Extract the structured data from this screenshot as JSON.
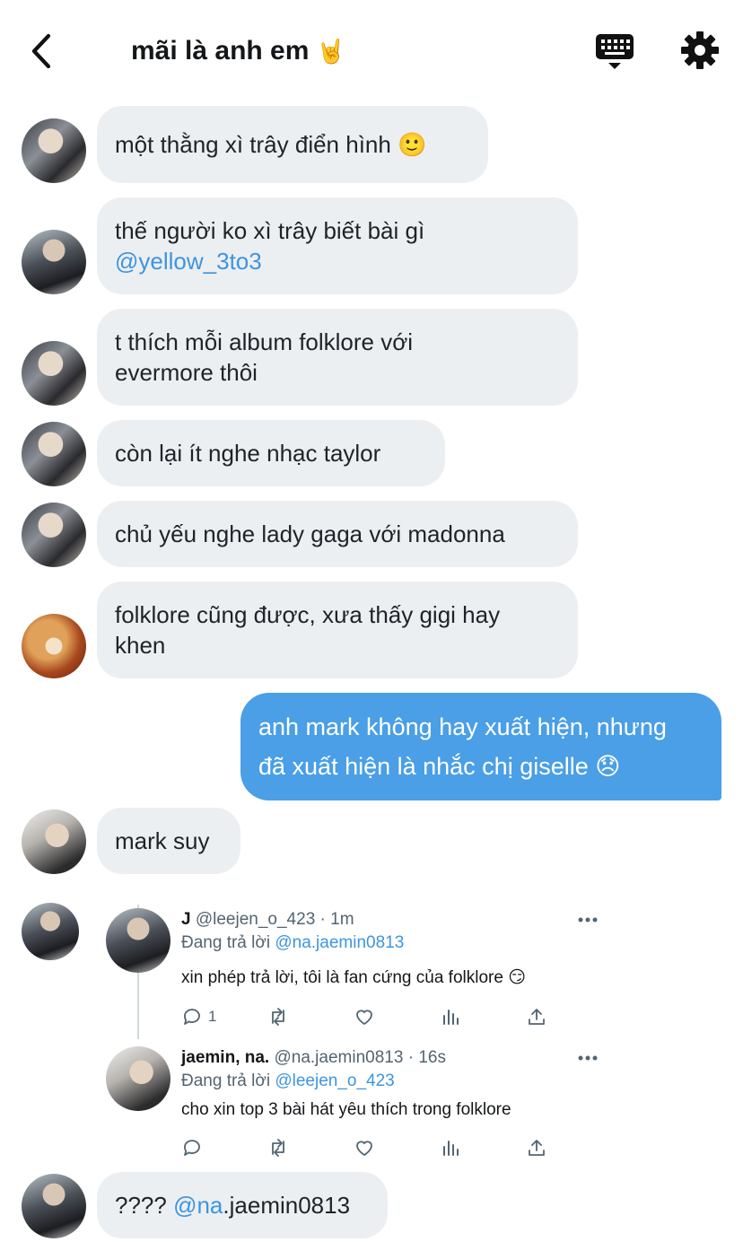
{
  "header": {
    "title": "mãi là anh em",
    "title_emoji": "🤘"
  },
  "messages": [
    {
      "text": "một thằng xì trây điển hình",
      "emoji": "🙂"
    },
    {
      "text": "thế người ko xì trây biết bài gì",
      "mention": "@yellow_3to3"
    },
    {
      "line1": "t thích mỗi album folklore với",
      "line2": "evermore thôi"
    },
    {
      "text": "còn lại ít nghe nhạc taylor"
    },
    {
      "text": "chủ yếu nghe lady gaga với madonna"
    },
    {
      "line1": "folklore cũng được, xưa thấy gigi hay",
      "line2": "khen"
    },
    {
      "line1": "anh mark không hay xuất hiện, nhưng",
      "line2": "đã xuất hiện là nhắc chị giselle",
      "emoji": "😞"
    },
    {
      "text": "mark suy"
    },
    {
      "mention_part": "@na",
      "rest": ".jaemin0813",
      "prefix": "????"
    }
  ],
  "tweets": [
    {
      "name": "J",
      "handle": "@leejen_o_423",
      "time": "· 1m",
      "replying_label": "Đang trả lời",
      "replying_to": "@na.jaemin0813",
      "text": "xin phép trả lời, tôi là fan cứng của folklore",
      "text_emoji": "😏",
      "reply_count": "1"
    },
    {
      "name": "jaemin, na.",
      "handle": "@na.jaemin0813",
      "time": "· 16s",
      "replying_label": "Đang trả lời",
      "replying_to": "@leejen_o_423",
      "text": "cho xin top 3 bài hát yêu thích trong folklore",
      "reply_count": ""
    }
  ],
  "colors": {
    "bubble_other": "#eceff2",
    "bubble_mine": "#4a9fe6",
    "mention": "#3d95e0",
    "muted": "#536471"
  },
  "icons": [
    "back-icon",
    "keyboard-icon",
    "gear-icon",
    "more-icon",
    "reply-icon",
    "retweet-icon",
    "like-icon",
    "views-icon",
    "share-icon"
  ]
}
